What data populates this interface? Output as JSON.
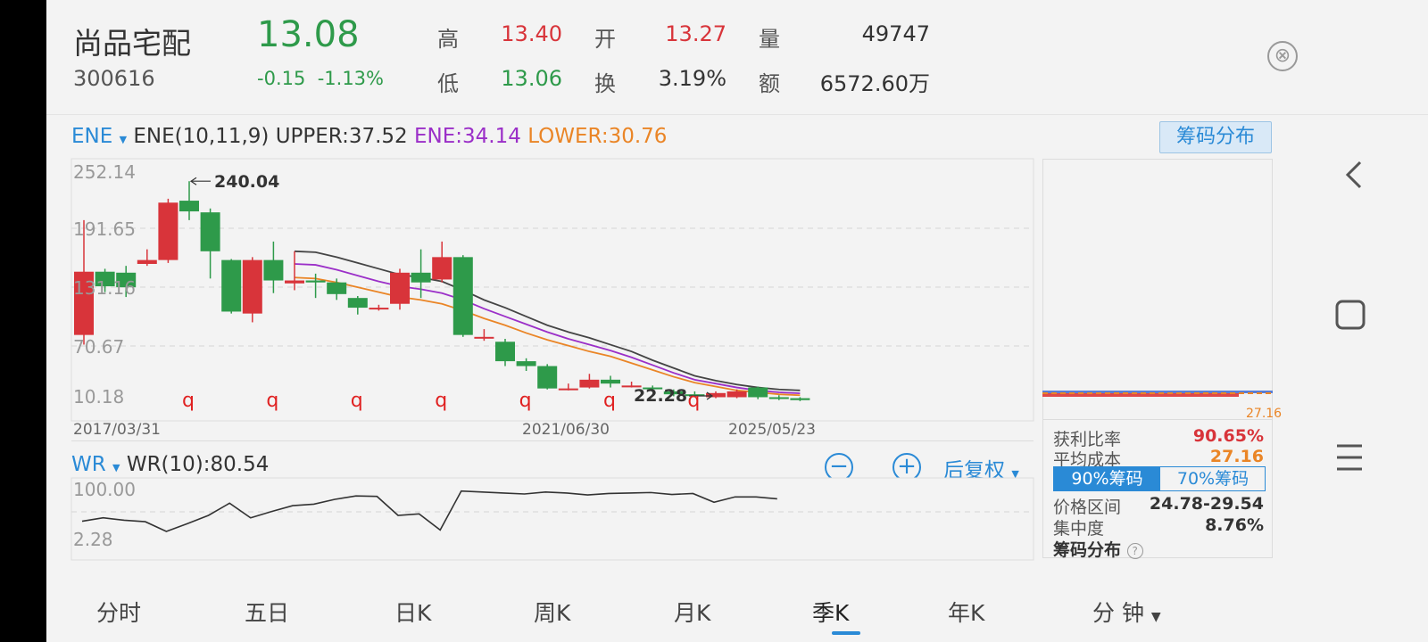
{
  "stock": {
    "name": "尚品宅配",
    "code": "300616",
    "price": "13.08",
    "change": "-0.15",
    "change_pct": "-1.13%"
  },
  "quote": {
    "high_label": "高",
    "high": "13.40",
    "open_label": "开",
    "open": "13.27",
    "volume_label": "量",
    "volume": "49747",
    "low_label": "低",
    "low": "13.06",
    "turnover_label": "换",
    "turnover": "3.19%",
    "amount_label": "额",
    "amount": "6572.60万"
  },
  "colors": {
    "up": "#d8343a",
    "down": "#2e9a4a",
    "accent": "#2a8ad6",
    "ene": "#9b2fc8",
    "lower": "#ea8526",
    "upper": "#444444"
  },
  "indicator": {
    "name": "ENE",
    "params": "ENE(10,11,9)",
    "upper": "UPPER:37.52",
    "ene": "ENE:34.14",
    "lower": "LOWER:30.76",
    "chip_button": "筹码分布"
  },
  "main_chart": {
    "y_ticks": [
      "252.14",
      "191.65",
      "131.16",
      "70.67",
      "10.18"
    ],
    "max_marker": "240.04",
    "min_marker": "22.28",
    "q_marker": "q",
    "dates": [
      "2017/03/31",
      "2021/06/30",
      "2025/05/23"
    ]
  },
  "chart_data": {
    "type": "candlestick",
    "x_labels": [
      "2017/03/31",
      "2021/06/30",
      "2025/05/23"
    ],
    "ylim": [
      10.18,
      252.14
    ],
    "candles": [
      {
        "o": 82,
        "c": 147,
        "h": 200,
        "l": 72
      },
      {
        "o": 147,
        "c": 132,
        "h": 150,
        "l": 126
      },
      {
        "o": 146,
        "c": 131,
        "h": 153,
        "l": 121
      },
      {
        "o": 155,
        "c": 159,
        "h": 170,
        "l": 153
      },
      {
        "o": 159,
        "c": 218,
        "h": 222,
        "l": 156
      },
      {
        "o": 220,
        "c": 209,
        "h": 240.04,
        "l": 200
      },
      {
        "o": 208,
        "c": 168,
        "h": 212,
        "l": 140
      },
      {
        "o": 159,
        "c": 106,
        "h": 160,
        "l": 104
      },
      {
        "o": 104,
        "c": 159,
        "h": 162,
        "l": 95
      },
      {
        "o": 159,
        "c": 138,
        "h": 178,
        "l": 125
      },
      {
        "o": 135,
        "c": 138,
        "h": 168,
        "l": 128
      },
      {
        "o": 138,
        "c": 136,
        "h": 145,
        "l": 120
      },
      {
        "o": 136,
        "c": 124,
        "h": 140,
        "l": 118
      },
      {
        "o": 120,
        "c": 110,
        "h": 122,
        "l": 103
      },
      {
        "o": 110,
        "c": 110,
        "h": 113,
        "l": 107
      },
      {
        "o": 114,
        "c": 146,
        "h": 150,
        "l": 108
      },
      {
        "o": 146,
        "c": 136,
        "h": 170,
        "l": 120
      },
      {
        "o": 139,
        "c": 162,
        "h": 178,
        "l": 136
      },
      {
        "o": 162,
        "c": 82,
        "h": 164,
        "l": 80
      },
      {
        "o": 80,
        "c": 80,
        "h": 88,
        "l": 76
      },
      {
        "o": 75,
        "c": 55,
        "h": 78,
        "l": 50
      },
      {
        "o": 55,
        "c": 50,
        "h": 58,
        "l": 45
      },
      {
        "o": 50,
        "c": 27,
        "h": 52,
        "l": 26
      },
      {
        "o": 27,
        "c": 27,
        "h": 32,
        "l": 25
      },
      {
        "o": 28,
        "c": 36,
        "h": 42,
        "l": 27
      },
      {
        "o": 36,
        "c": 32,
        "h": 40,
        "l": 28
      },
      {
        "o": 30,
        "c": 30,
        "h": 34,
        "l": 28
      },
      {
        "o": 28,
        "c": 27,
        "h": 30,
        "l": 25
      },
      {
        "o": 24,
        "c": 21,
        "h": 26,
        "l": 19
      },
      {
        "o": 21,
        "c": 20,
        "h": 24,
        "l": 18
      },
      {
        "o": 18,
        "c": 22.28,
        "h": 24,
        "l": 17
      },
      {
        "o": 18,
        "c": 24,
        "h": 26,
        "l": 17
      },
      {
        "o": 28,
        "c": 18,
        "h": 29,
        "l": 16
      },
      {
        "o": 18,
        "c": 17,
        "h": 20,
        "l": 15
      },
      {
        "o": 17,
        "c": 15,
        "h": 18,
        "l": 14
      }
    ],
    "series": [
      {
        "name": "UPPER",
        "start_index": 10,
        "values": [
          168,
          167,
          162,
          156,
          150,
          144,
          141,
          137,
          128,
          118,
          110,
          101,
          92,
          85,
          79,
          72,
          65,
          56,
          48,
          40,
          35,
          31,
          28,
          26,
          25
        ]
      },
      {
        "name": "ENE",
        "start_index": 10,
        "values": [
          155,
          154,
          149,
          143,
          137,
          132,
          129,
          125,
          118,
          109,
          101,
          93,
          85,
          78,
          72,
          66,
          59,
          51,
          43,
          36,
          32,
          28,
          25,
          23,
          22
        ]
      },
      {
        "name": "LOWER",
        "start_index": 10,
        "values": [
          141,
          140,
          136,
          131,
          126,
          121,
          118,
          114,
          107,
          99,
          92,
          84,
          77,
          71,
          65,
          60,
          53,
          46,
          39,
          33,
          29,
          25,
          23,
          21,
          20
        ]
      }
    ]
  },
  "wr": {
    "name": "WR",
    "label": "WR(10):80.54",
    "y_ticks": [
      "100.00",
      "2.28"
    ],
    "zoom_out": "−",
    "zoom_in": "+",
    "adjust": "后复权",
    "values": [
      43,
      50,
      45,
      42,
      22,
      38,
      55,
      80,
      50,
      63,
      75,
      78,
      88,
      95,
      94,
      55,
      58,
      25,
      105,
      103,
      101,
      99,
      103,
      101,
      97,
      100,
      101,
      102,
      98,
      100,
      82,
      93,
      93,
      89
    ]
  },
  "chip": {
    "price_label": "27.16",
    "profit_label": "获利比率",
    "profit": "90.65%",
    "avg_cost_label": "平均成本",
    "avg_cost": "27.16",
    "tab_90": "90%筹码",
    "tab_70": "70%筹码",
    "range_label": "价格区间",
    "range": "24.78-29.54",
    "concentration_label": "集中度",
    "concentration": "8.76%",
    "footer": "筹码分布",
    "help": "?"
  },
  "tabs": [
    "分时",
    "五日",
    "日K",
    "周K",
    "月K",
    "季K",
    "年K",
    "分 钟"
  ],
  "active_tab": "季K",
  "close": "⊗"
}
